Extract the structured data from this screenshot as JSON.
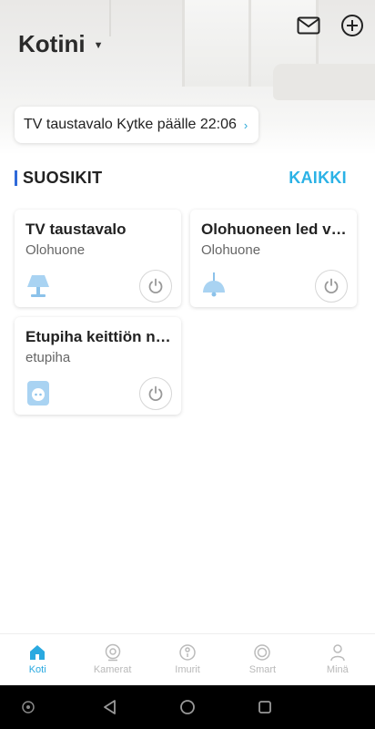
{
  "header": {
    "home_name": "Kotini",
    "caret_icon": "caret-down-icon",
    "mail_icon": "mail-icon",
    "add_icon": "plus-circle-icon"
  },
  "notice": {
    "text": "TV taustavalo Kytke päälle 22:06",
    "chevron": "›"
  },
  "favorites": {
    "title": "SUOSIKIT",
    "all_label": "KAIKKI",
    "accent": "#2f6ad9",
    "link_color": "#2bb2e6",
    "cards": [
      {
        "name": "TV taustavalo",
        "room": "Olohuone",
        "icon": "table-lamp-icon"
      },
      {
        "name": "Olohuoneen led valot",
        "room": "Olohuone",
        "icon": "ceiling-lamp-icon"
      },
      {
        "name": "Etupiha keittiön nurkka",
        "room": "etupiha",
        "icon": "smart-plug-icon"
      }
    ]
  },
  "bottom_nav": {
    "active_color": "#2aa9e0",
    "items": [
      {
        "label": "Koti",
        "icon": "home-icon",
        "active": true
      },
      {
        "label": "Kamerat",
        "icon": "camera-icon",
        "active": false
      },
      {
        "label": "Imurit",
        "icon": "vacuum-icon",
        "active": false
      },
      {
        "label": "Smart",
        "icon": "smart-icon",
        "active": false
      },
      {
        "label": "Minä",
        "icon": "person-icon",
        "active": false
      }
    ]
  },
  "system_nav": {
    "icons": [
      "assistant-icon",
      "back-icon",
      "home-circle-icon",
      "recents-icon"
    ]
  }
}
